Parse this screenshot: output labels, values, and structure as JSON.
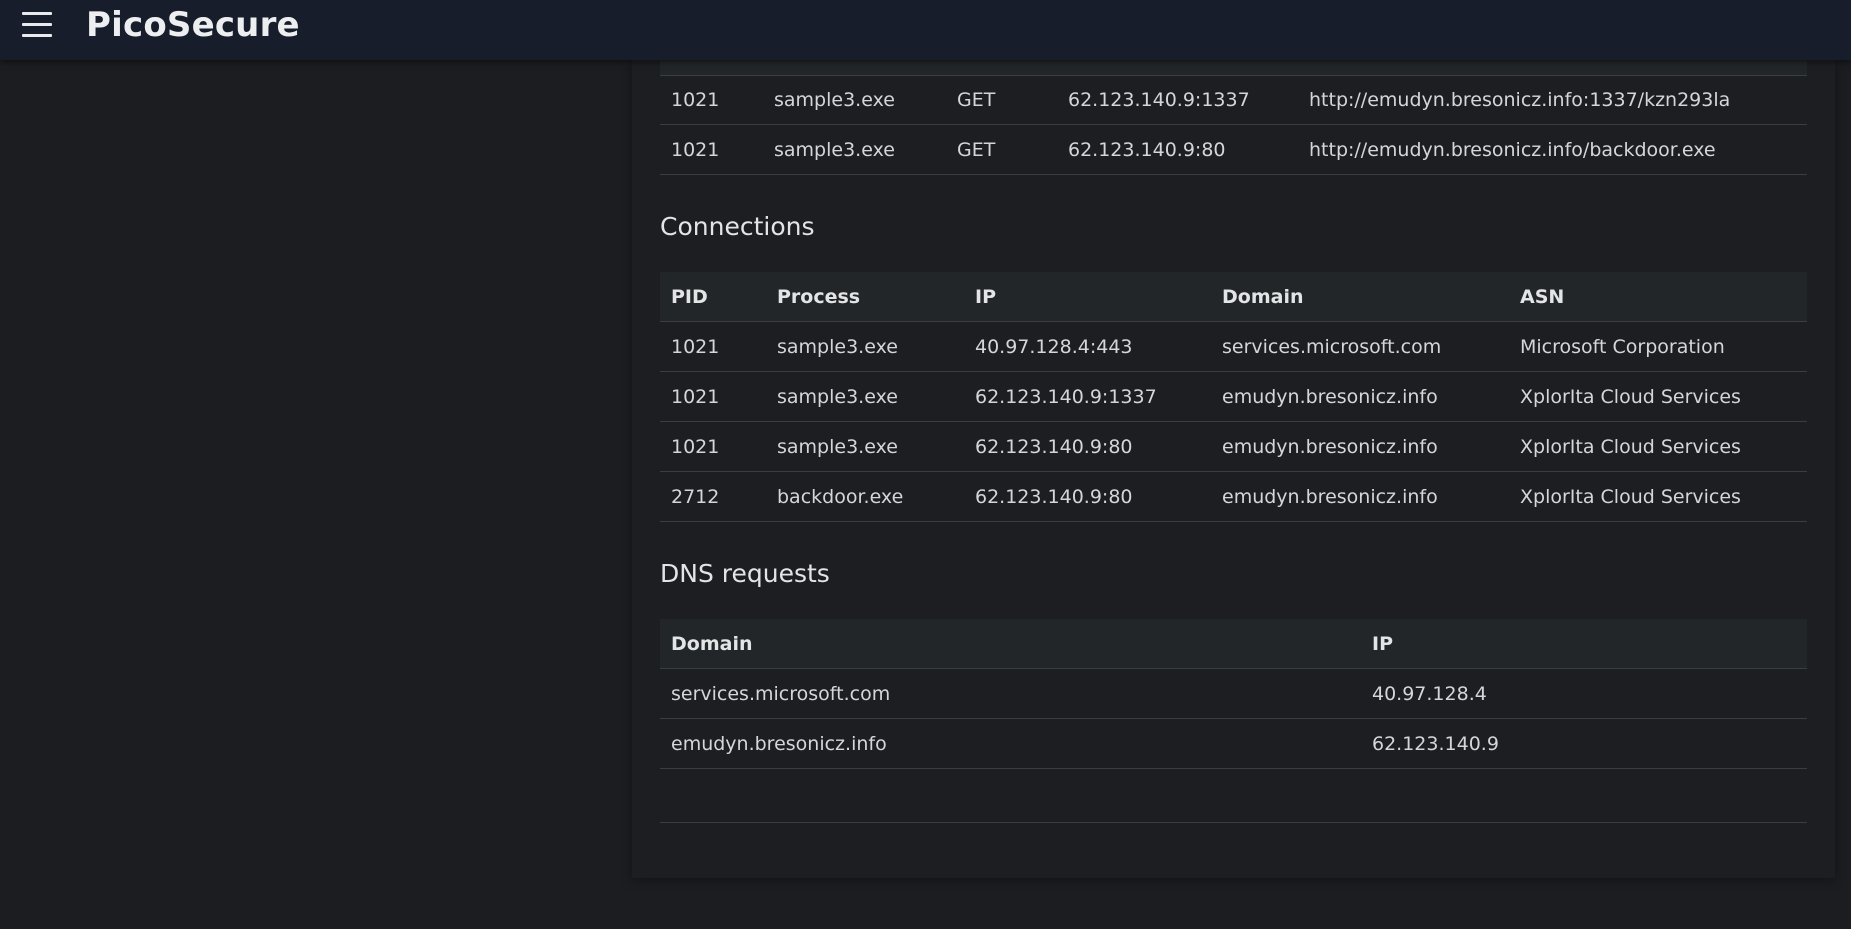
{
  "app": {
    "title": "PicoSecure"
  },
  "http_requests": {
    "rows": [
      {
        "pid": "1021",
        "process": "sample3.exe",
        "method": "GET",
        "ip": "62.123.140.9:1337",
        "url": "http://emudyn.bresonicz.info:1337/kzn293la"
      },
      {
        "pid": "1021",
        "process": "sample3.exe",
        "method": "GET",
        "ip": "62.123.140.9:80",
        "url": "http://emudyn.bresonicz.info/backdoor.exe"
      }
    ]
  },
  "connections": {
    "title": "Connections",
    "headers": {
      "pid": "PID",
      "process": "Process",
      "ip": "IP",
      "domain": "Domain",
      "asn": "ASN"
    },
    "rows": [
      {
        "pid": "1021",
        "process": "sample3.exe",
        "ip": "40.97.128.4:443",
        "domain": "services.microsoft.com",
        "asn": "Microsoft Corporation"
      },
      {
        "pid": "1021",
        "process": "sample3.exe",
        "ip": "62.123.140.9:1337",
        "domain": "emudyn.bresonicz.info",
        "asn": "XplorIta Cloud Services"
      },
      {
        "pid": "1021",
        "process": "sample3.exe",
        "ip": "62.123.140.9:80",
        "domain": "emudyn.bresonicz.info",
        "asn": "XplorIta Cloud Services"
      },
      {
        "pid": "2712",
        "process": "backdoor.exe",
        "ip": "62.123.140.9:80",
        "domain": "emudyn.bresonicz.info",
        "asn": "XplorIta Cloud Services"
      }
    ]
  },
  "dns": {
    "title": "DNS requests",
    "headers": {
      "domain": "Domain",
      "ip": "IP"
    },
    "rows": [
      {
        "domain": "services.microsoft.com",
        "ip": "40.97.128.4"
      },
      {
        "domain": "emudyn.bresonicz.info",
        "ip": "62.123.140.9"
      }
    ]
  },
  "colors": {
    "topbar": "#171d2b",
    "background": "#1b1d20",
    "table_header": "#232628",
    "divider": "#3a3d41"
  }
}
